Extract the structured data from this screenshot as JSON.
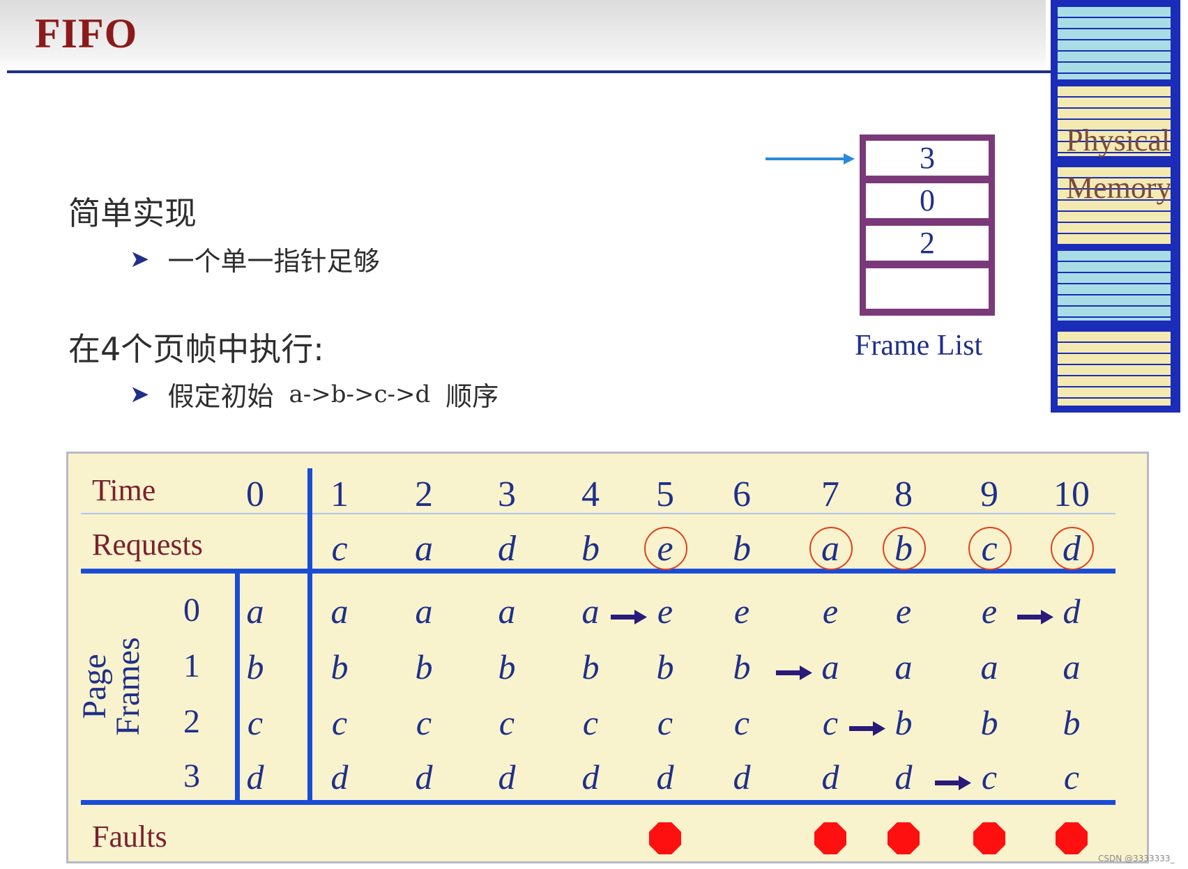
{
  "slide": {
    "title": "FIFO"
  },
  "physical_memory": {
    "line1": "Physical",
    "line2": "Memory"
  },
  "text": {
    "heading1": "简单实现",
    "bullet1": "一个单一指针足够",
    "heading2": "在4个页帧中执行:",
    "bullet2_prefix": "假定初始",
    "bullet2_seq": "a->b->c->d",
    "bullet2_suffix": "顺序"
  },
  "frame_list": {
    "cells": [
      "3",
      "0",
      "2",
      ""
    ],
    "label": "Frame List"
  },
  "table": {
    "time_label": "Time",
    "requests_label": "Requests",
    "page_frames_label": [
      "Page",
      "Frames"
    ],
    "faults_label": "Faults",
    "times": [
      "0",
      "1",
      "2",
      "3",
      "4",
      "5",
      "6",
      "7",
      "8",
      "9",
      "10"
    ],
    "requests": [
      "",
      "c",
      "a",
      "d",
      "b",
      "e",
      "b",
      "a",
      "b",
      "c",
      "d"
    ],
    "frame_rows": [
      {
        "index": "0",
        "cells": [
          "a",
          "a",
          "a",
          "a",
          "a",
          "e",
          "e",
          "e",
          "e",
          "e",
          "d"
        ]
      },
      {
        "index": "1",
        "cells": [
          "b",
          "b",
          "b",
          "b",
          "b",
          "b",
          "b",
          "a",
          "a",
          "a",
          "a"
        ]
      },
      {
        "index": "2",
        "cells": [
          "c",
          "c",
          "c",
          "c",
          "c",
          "c",
          "c",
          "c",
          "b",
          "b",
          "b"
        ]
      },
      {
        "index": "3",
        "cells": [
          "d",
          "d",
          "d",
          "d",
          "d",
          "d",
          "d",
          "d",
          "d",
          "c",
          "c"
        ]
      }
    ],
    "replacements": [
      {
        "row": 0,
        "time": 5
      },
      {
        "row": 0,
        "time": 10
      },
      {
        "row": 1,
        "time": 7
      },
      {
        "row": 2,
        "time": 8
      },
      {
        "row": 3,
        "time": 9
      }
    ],
    "faults_at_times": [
      5,
      7,
      8,
      9,
      10
    ],
    "colors": {
      "ink": "#1f2f8a",
      "rule": "#1a4cd8",
      "fault": "#ff1010",
      "circle": "#e0401e",
      "panel": "#f8f3cc"
    }
  },
  "watermark": "CSDN @3333333_"
}
